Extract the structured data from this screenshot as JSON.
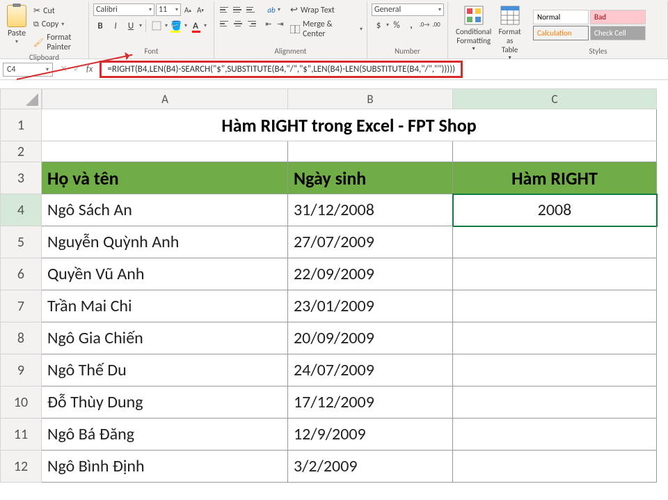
{
  "ribbon": {
    "clipboard": {
      "label": "Clipboard",
      "paste": "Paste",
      "cut": "Cut",
      "copy": "Copy",
      "painter": "Format Painter"
    },
    "font": {
      "label": "Font",
      "name": "Calibri",
      "size": "11",
      "bold": "B",
      "italic": "I",
      "underline": "U"
    },
    "alignment": {
      "label": "Alignment",
      "wrap": "Wrap Text",
      "merge": "Merge & Center"
    },
    "number": {
      "label": "Number",
      "format": "General"
    },
    "cond": "Conditional Formatting",
    "fmtTable": "Format as Table",
    "styles": {
      "label": "Styles",
      "normal": "Normal",
      "bad": "Bad",
      "calc": "Calculation",
      "check": "Check Cell"
    }
  },
  "namebox": "C4",
  "formula": "=RIGHT(B4,LEN(B4)-SEARCH(\"$\",SUBSTITUTE(B4,\"/\",\"$\",LEN(B4)-LEN(SUBSTITUTE(B4,\"/\",\"\")))))",
  "cols": {
    "A": "A",
    "B": "B",
    "C": "C"
  },
  "title": "Hàm RIGHT trong Excel - FPT Shop",
  "hdr": {
    "a": "Họ và tên",
    "b": "Ngày sinh",
    "c": "Hàm RIGHT"
  },
  "rows": [
    {
      "n": "4",
      "a": "Ngô Sách An",
      "b": "31/12/2008",
      "c": "2008"
    },
    {
      "n": "5",
      "a": "Nguyễn Quỳnh Anh",
      "b": "27/07/2009",
      "c": ""
    },
    {
      "n": "6",
      "a": "Quyền Vũ Anh",
      "b": "22/09/2009",
      "c": ""
    },
    {
      "n": "7",
      "a": "Trần Mai Chi",
      "b": "23/01/2009",
      "c": ""
    },
    {
      "n": "8",
      "a": "Ngô Gia Chiến",
      "b": "20/09/2009",
      "c": ""
    },
    {
      "n": "9",
      "a": "Ngô Thế Du",
      "b": "24/07/2009",
      "c": ""
    },
    {
      "n": "10",
      "a": "Đỗ Thùy Dung",
      "b": "17/12/2009",
      "c": ""
    },
    {
      "n": "11",
      "a": "Ngô Bá Đăng",
      "b": "12/9/2009",
      "c": ""
    },
    {
      "n": "12",
      "a": "Ngô Bình Định",
      "b": "3/2/2009",
      "c": ""
    }
  ]
}
